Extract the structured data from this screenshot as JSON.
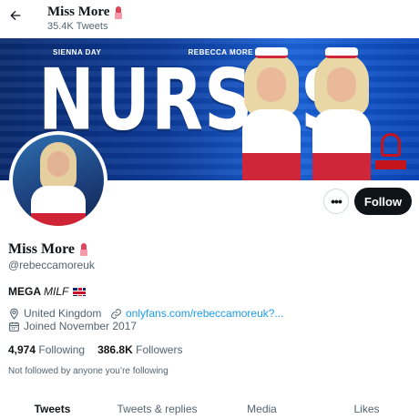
{
  "header": {
    "title": "Miss More",
    "title_emoji_icon": "lipstick-icon",
    "subtitle": "35.4K Tweets",
    "back_icon": "arrow-left-icon"
  },
  "banner": {
    "name_left": "SIENNA DAY",
    "name_right": "REBECCA MORE",
    "headline": "NURSES",
    "colors": {
      "background": "#0d3c9c",
      "accent_red": "#d0263a"
    }
  },
  "actions": {
    "more_icon": "ellipsis-icon",
    "more_label": "•••",
    "follow_label": "Follow"
  },
  "profile": {
    "display_name": "Miss More",
    "name_emoji_icon": "lipstick-icon",
    "handle": "@rebeccamoreuk",
    "bio_bold": "MEGA",
    "bio_italic": "MILF",
    "bio_flag_icon": "uk-flag-icon",
    "location": "United Kingdom",
    "location_icon": "location-pin-icon",
    "link": "onlyfans.com/rebeccamoreuk?...",
    "link_icon": "link-icon",
    "joined": "Joined November 2017",
    "joined_icon": "calendar-icon"
  },
  "stats": {
    "following_count": "4,974",
    "following_label": "Following",
    "followers_count": "386.8K",
    "followers_label": "Followers"
  },
  "not_followed_text": "Not followed by anyone you’re following",
  "tabs": [
    {
      "label": "Tweets",
      "active": true
    },
    {
      "label": "Tweets & replies",
      "active": false
    },
    {
      "label": "Media",
      "active": false
    },
    {
      "label": "Likes",
      "active": false
    }
  ],
  "colors": {
    "text_primary": "#0f1419",
    "text_secondary": "#536471",
    "link": "#1d9bf0",
    "follow_button": "#0f1419"
  }
}
